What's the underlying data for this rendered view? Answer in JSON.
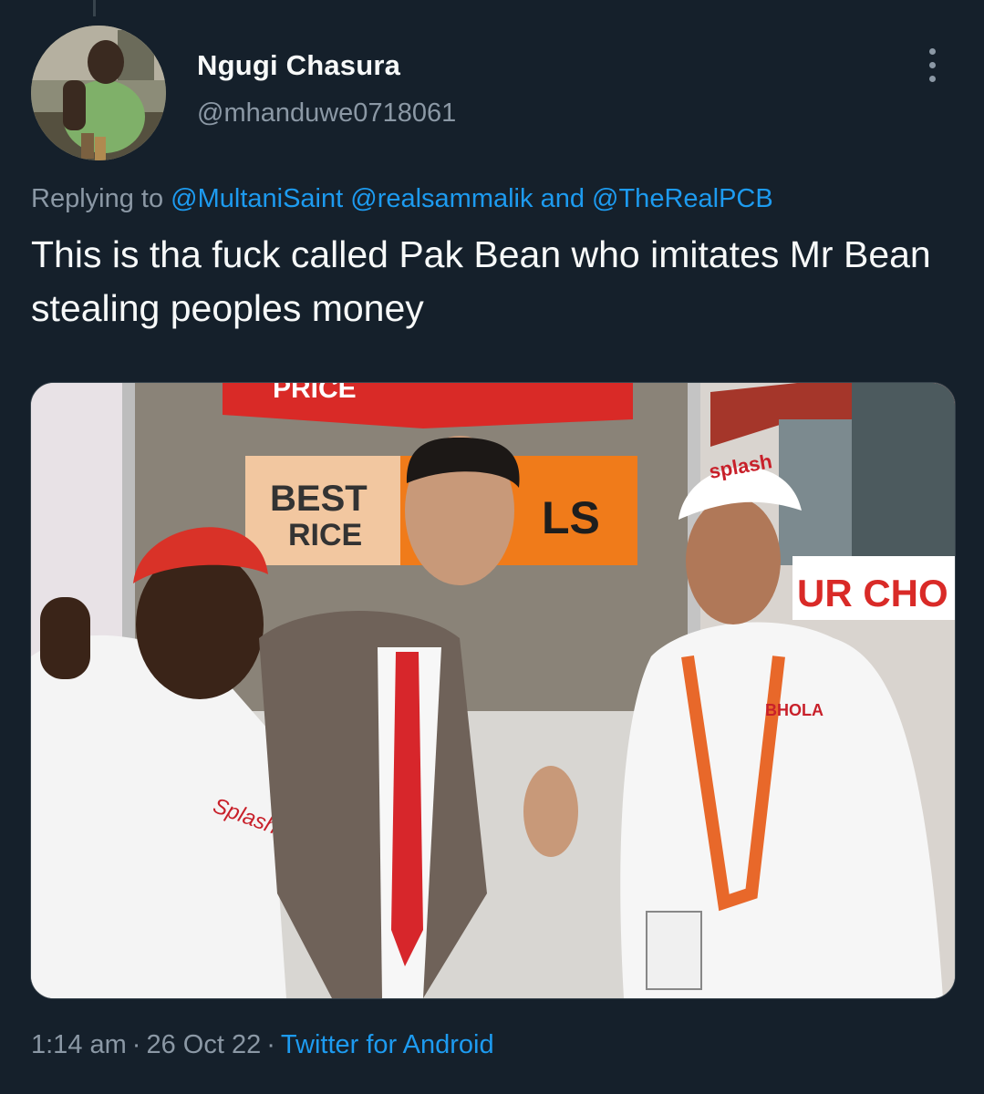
{
  "author": {
    "display_name": "Ngugi Chasura",
    "handle": "@mhanduwe0718061",
    "avatar_icon": "profile-photo"
  },
  "more_icon": "more-options-icon",
  "reply": {
    "prefix": "Replying to",
    "mention_1": "@MultaniSaint",
    "mention_2": "@realsammalik",
    "conjunction": "and",
    "mention_3": "@TheRealPCB"
  },
  "tweet_text": "This is tha fuck called Pak Bean who imitates Mr Bean stealing peoples money",
  "media": {
    "sign_price": "PRICE",
    "sign_best": "BEST",
    "sign_rice": "RICE",
    "sign_ls": "LS",
    "sign_our_cho": "UR CHO",
    "cap_logo": "splash",
    "shirt_logo_left": "Splash",
    "shirt_logo_right": "BHOLA"
  },
  "meta": {
    "time": "1:14 am",
    "date": "26 Oct 22",
    "separator": "·",
    "source": "Twitter for Android"
  },
  "colors": {
    "background": "#15202b",
    "text": "#f7f9f9",
    "secondary": "#8b98a5",
    "link": "#1d9bf0",
    "border": "#38444d"
  }
}
